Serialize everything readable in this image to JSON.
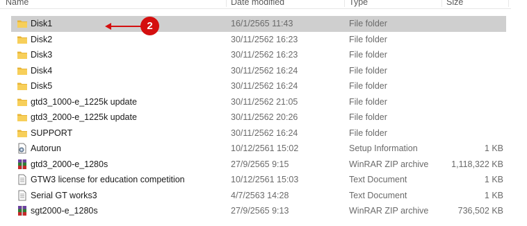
{
  "columns": {
    "name": "Name",
    "date": "Date modified",
    "type": "Type",
    "size": "Size"
  },
  "rows": [
    {
      "name": "Disk1",
      "date": "16/1/2565 11:43",
      "type": "File folder",
      "size": "",
      "icon": "folder-icon",
      "selected": true
    },
    {
      "name": "Disk2",
      "date": "30/11/2562 16:23",
      "type": "File folder",
      "size": "",
      "icon": "folder-icon"
    },
    {
      "name": "Disk3",
      "date": "30/11/2562 16:23",
      "type": "File folder",
      "size": "",
      "icon": "folder-icon"
    },
    {
      "name": "Disk4",
      "date": "30/11/2562 16:24",
      "type": "File folder",
      "size": "",
      "icon": "folder-icon"
    },
    {
      "name": "Disk5",
      "date": "30/11/2562 16:24",
      "type": "File folder",
      "size": "",
      "icon": "folder-icon"
    },
    {
      "name": "gtd3_1000-e_1225k update",
      "date": "30/11/2562 21:05",
      "type": "File folder",
      "size": "",
      "icon": "folder-icon"
    },
    {
      "name": "gtd3_2000-e_1225k update",
      "date": "30/11/2562 20:26",
      "type": "File folder",
      "size": "",
      "icon": "folder-icon"
    },
    {
      "name": "SUPPORT",
      "date": "30/11/2562 16:24",
      "type": "File folder",
      "size": "",
      "icon": "folder-icon"
    },
    {
      "name": "Autorun",
      "date": "10/12/2561 15:02",
      "type": "Setup Information",
      "size": "1 KB",
      "icon": "setup-info-icon"
    },
    {
      "name": "gtd3_2000-e_1280s",
      "date": "27/9/2565 9:15",
      "type": "WinRAR ZIP archive",
      "size": "1,118,322 KB",
      "icon": "winrar-icon"
    },
    {
      "name": "GTW3 license for education competition",
      "date": "10/12/2561 15:03",
      "type": "Text Document",
      "size": "1 KB",
      "icon": "text-document-icon"
    },
    {
      "name": "Serial GT works3",
      "date": "4/7/2563 14:28",
      "type": "Text Document",
      "size": "1 KB",
      "icon": "text-document-icon"
    },
    {
      "name": "sgt2000-e_1280s",
      "date": "27/9/2565 9:13",
      "type": "WinRAR ZIP archive",
      "size": "736,502 KB",
      "icon": "winrar-icon"
    }
  ],
  "annotation": {
    "badge": "2",
    "color": "#d40f0f"
  },
  "colors": {
    "selected_row": "#cfcfcf",
    "folder": "#f0c14b"
  }
}
